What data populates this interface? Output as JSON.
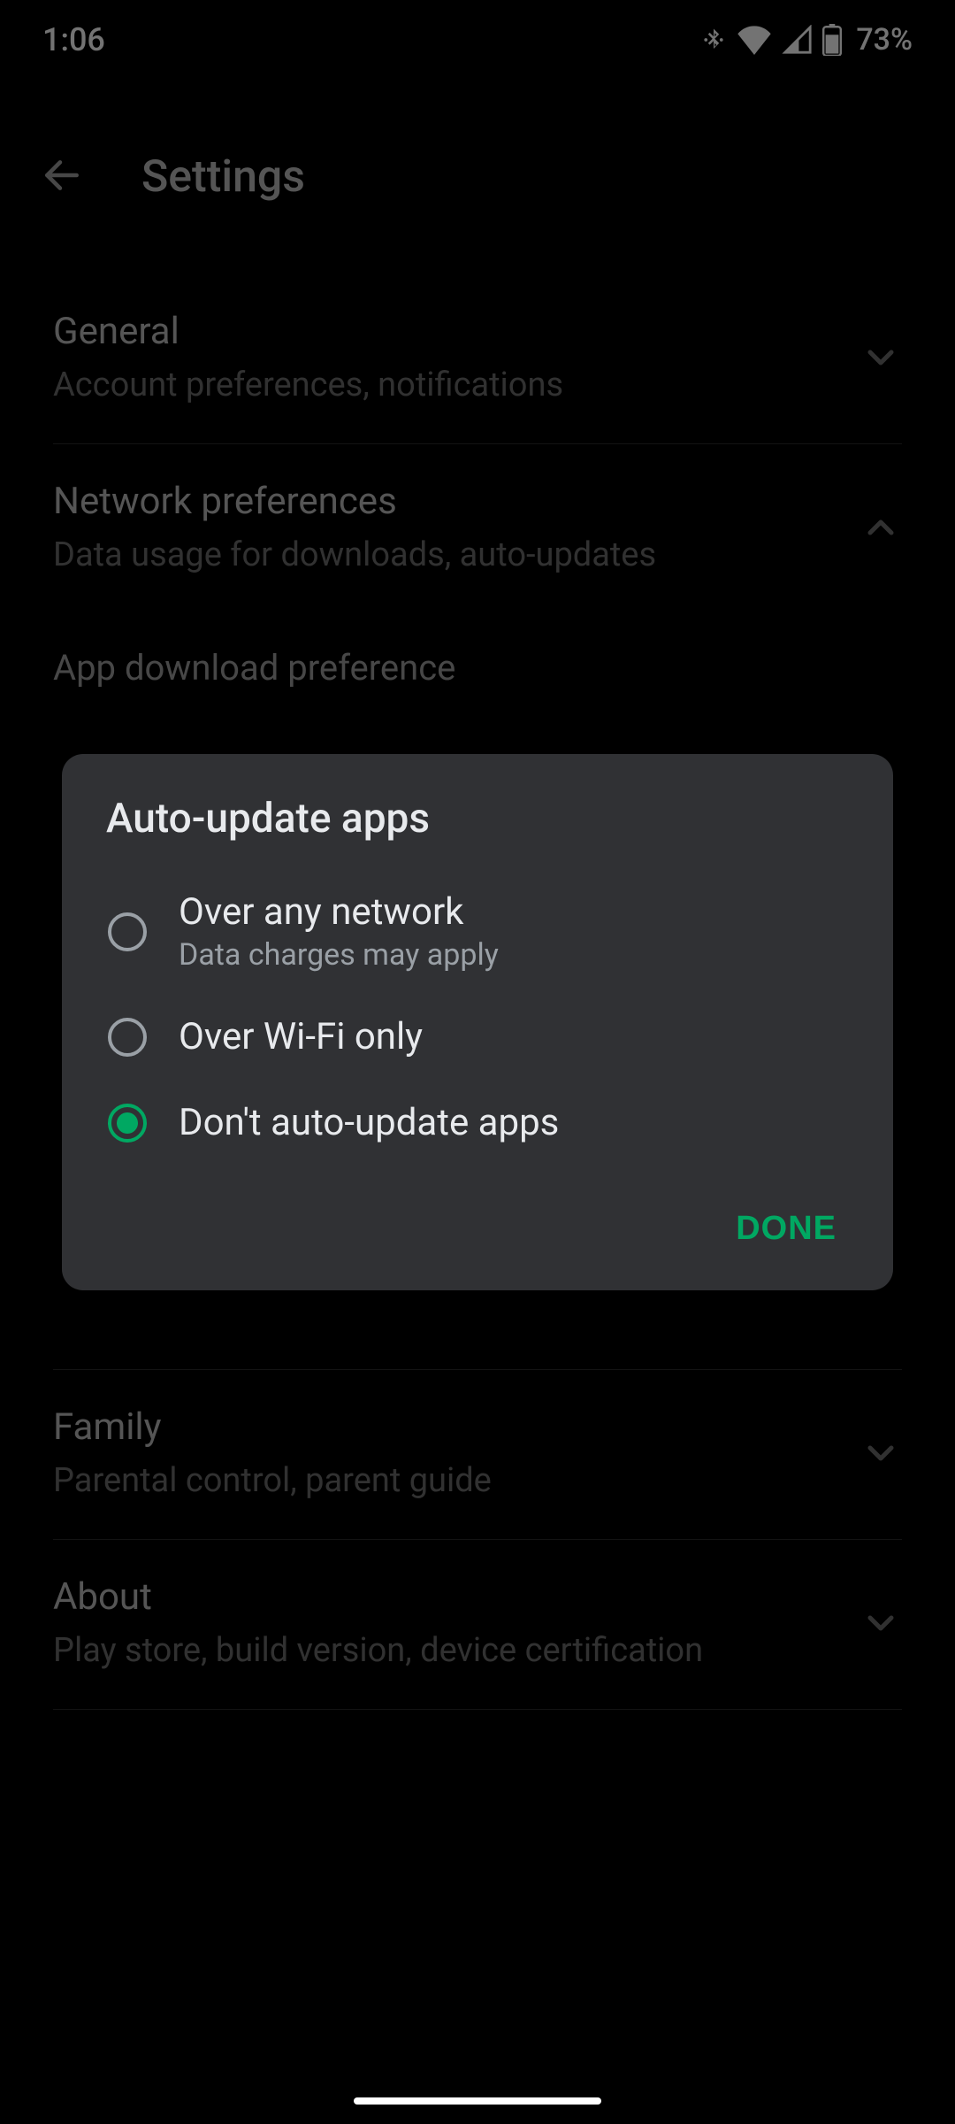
{
  "status": {
    "time": "1:06",
    "battery": "73%"
  },
  "appbar": {
    "title": "Settings"
  },
  "sections": {
    "general": {
      "title": "General",
      "sub": "Account preferences, notifications"
    },
    "network": {
      "title": "Network preferences",
      "sub": "Data usage for downloads, auto-updates"
    },
    "network_sub1": {
      "title": "App download preference"
    },
    "family": {
      "title": "Family",
      "sub": "Parental control, parent guide"
    },
    "about": {
      "title": "About",
      "sub": "Play store, build version, device certification"
    }
  },
  "dialog": {
    "title": "Auto-update apps",
    "options": [
      {
        "label": "Over any network",
        "sub": "Data charges may apply",
        "selected": false
      },
      {
        "label": "Over Wi-Fi only",
        "sub": "",
        "selected": false
      },
      {
        "label": "Don't auto-update apps",
        "sub": "",
        "selected": true
      }
    ],
    "done": "DONE"
  }
}
